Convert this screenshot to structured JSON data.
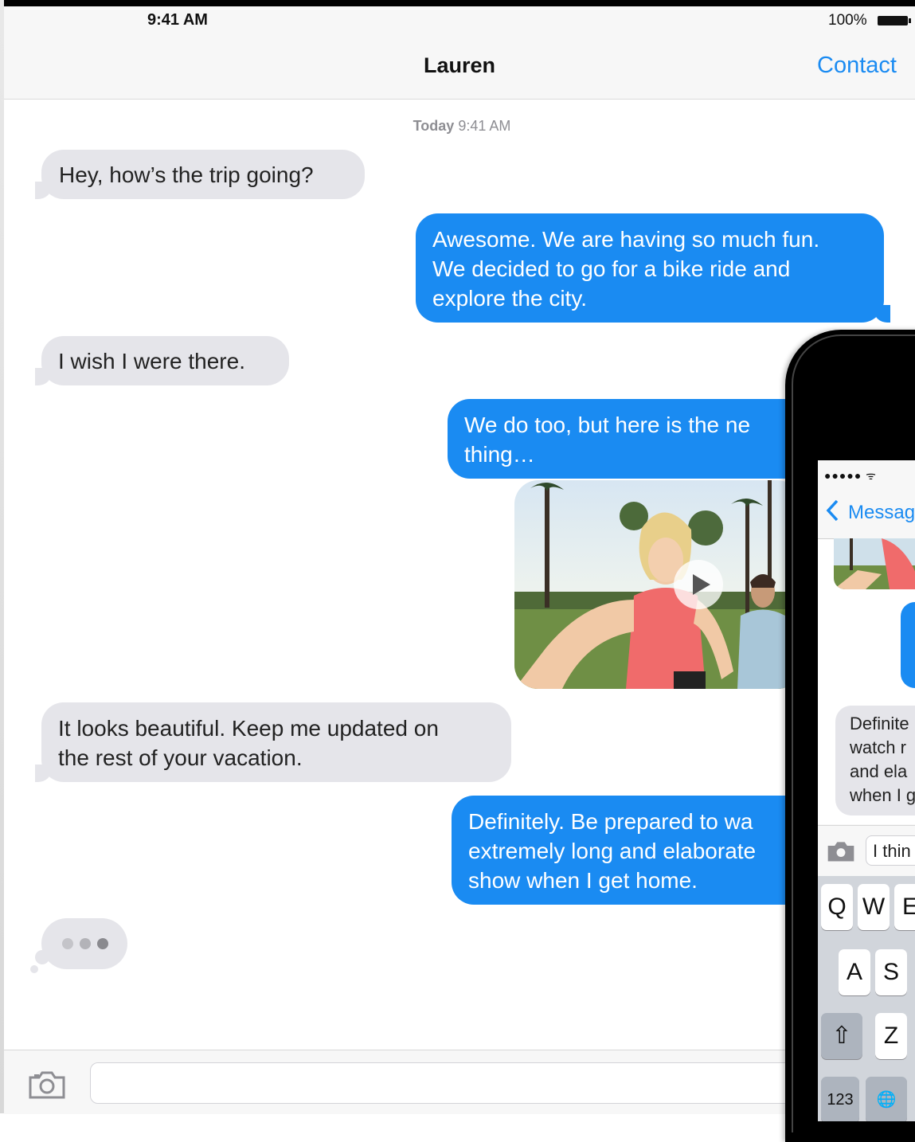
{
  "status_bar": {
    "time": "9:41 AM",
    "battery": "100%"
  },
  "nav": {
    "title": "Lauren",
    "contact_label": "Contact"
  },
  "timestamp": {
    "day": "Today",
    "time": "9:41 AM"
  },
  "messages": [
    {
      "from": "contact",
      "text": "Hey, how’s the trip going?"
    },
    {
      "from": "me",
      "lines": [
        "Awesome. We are having so much fun.",
        "We decided to go for a bike ride and",
        "explore the city."
      ]
    },
    {
      "from": "contact",
      "text": "I wish I were there."
    },
    {
      "from": "me",
      "lines": [
        "We do too, but here is the ne",
        "thing…"
      ]
    },
    {
      "from": "contact",
      "lines": [
        "It looks beautiful. Keep me updated on",
        "the rest of your vacation."
      ]
    },
    {
      "from": "me",
      "lines": [
        "Definitely. Be prepared to wa",
        "extremely long and elaborate",
        "show when I get home."
      ]
    }
  ],
  "colors": {
    "accent": "#1a8bf2",
    "incoming_bubble": "#e5e5ea",
    "typing_dots": [
      "#bcbcc2",
      "#bcbcc2",
      "#888"
    ]
  },
  "input_bar": {
    "camera_icon": "camera-icon",
    "placeholder": ""
  },
  "iphone": {
    "status": "●●●●● ᯤ",
    "back_label": "Messag",
    "incoming_lines": [
      "Definite",
      "watch r",
      "and ela",
      "when I g"
    ],
    "input_text": "I thin",
    "keyboard": {
      "row1": [
        "Q",
        "W",
        "E"
      ],
      "row2": [
        "A",
        "S"
      ],
      "row3": [
        "⇧",
        "Z"
      ],
      "row4": [
        "123",
        "🌐"
      ]
    }
  }
}
